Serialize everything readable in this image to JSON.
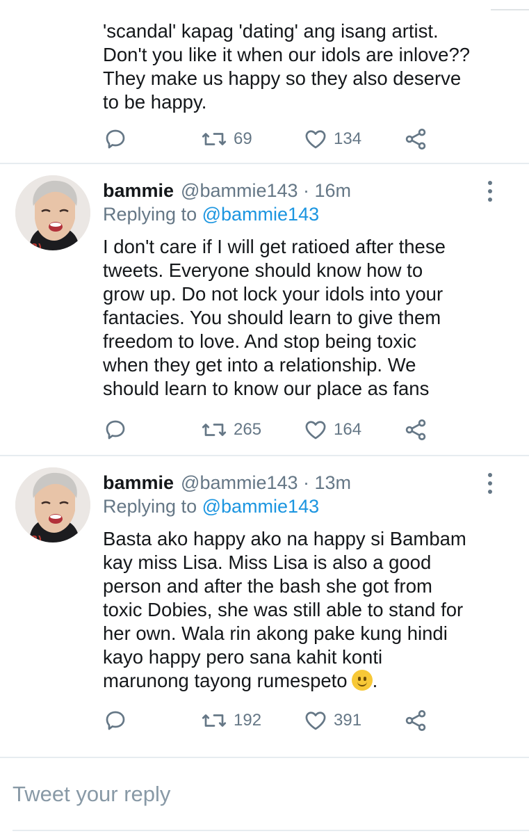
{
  "tweets": [
    {
      "partial": true,
      "body": "'scandal' kapag 'dating' ang isang artist.\nDon't you like it when our idols are inlove??\nThey make us happy so they also deserve\nto be happy.",
      "retweets": "69",
      "likes": "134"
    },
    {
      "name": "bammie",
      "handle": "@bammie143 · 16m",
      "replying_label": "Replying to",
      "replying_to": "@bammie143",
      "body": "I don't care if I will get ratioed after these\ntweets. Everyone should know how to\ngrow up. Do not lock your idols into your\nfantacies. You should learn to give them\nfreedom to love. And stop being toxic\nwhen they get into a relationship. We\nshould learn to know our place as fans",
      "retweets": "265",
      "likes": "164"
    },
    {
      "name": "bammie",
      "handle": "@bammie143 · 13m",
      "replying_label": "Replying to",
      "replying_to": "@bammie143",
      "body": "Basta ako happy ako na happy si Bambam\nkay miss Lisa. Miss Lisa is also a good\nperson and after the bash she got from\ntoxic Dobies, she was still able to stand for\nher own. Wala rin akong pake kung hindi\nkayo happy pero sana kahit konti\nmarunong tayong rumespeto",
      "body_end": ".",
      "retweets": "192",
      "likes": "391"
    }
  ],
  "reply_box": {
    "placeholder": "Tweet your reply"
  },
  "icons": {
    "reply": "reply-icon",
    "retweet": "retweet-icon",
    "like": "heart-icon",
    "share": "share-icon",
    "more": "more-vertical-icon",
    "emoji": "slightly-smiling-face-icon"
  },
  "colors": {
    "text": "#14171a",
    "muted": "#657786",
    "link": "#1b95e0",
    "divider": "#e6ecf0"
  }
}
